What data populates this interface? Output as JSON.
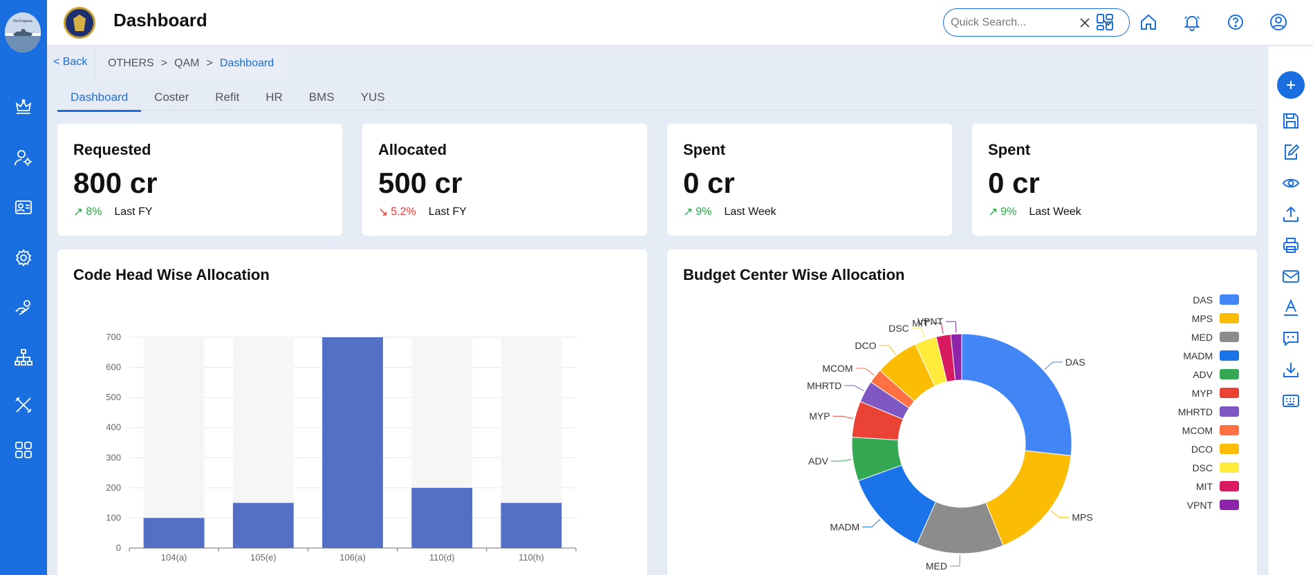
{
  "app": {
    "page_title": "Dashboard",
    "logo_caption": "RevTrapana"
  },
  "search": {
    "placeholder": "Quick Search..."
  },
  "breadcrumb": {
    "back": "< Back",
    "items": [
      "OTHERS",
      "QAM",
      "Dashboard"
    ],
    "separator": ">"
  },
  "tabs": [
    {
      "label": "Dashboard",
      "active": true
    },
    {
      "label": "Coster"
    },
    {
      "label": "Refit"
    },
    {
      "label": "HR"
    },
    {
      "label": "BMS"
    },
    {
      "label": "YUS"
    }
  ],
  "kpis": [
    {
      "title": "Requested",
      "value": "800 cr",
      "trend_arrow": "↗",
      "trend": "8%",
      "direction": "up",
      "period": "Last FY"
    },
    {
      "title": "Allocated",
      "value": "500 cr",
      "trend_arrow": "↘",
      "trend": "5.2%",
      "direction": "down",
      "period": "Last FY"
    },
    {
      "title": "Spent",
      "value": "0 cr",
      "trend_arrow": "↗",
      "trend": "9%",
      "direction": "up",
      "period": "Last Week"
    },
    {
      "title": "Spent",
      "value": "0 cr",
      "trend_arrow": "↗",
      "trend": "9%",
      "direction": "up",
      "period": "Last Week"
    }
  ],
  "sidebar_icons": [
    "crown-icon",
    "user-settings-icon",
    "id-card-icon",
    "settings-icon",
    "hand-coin-icon",
    "org-chart-icon",
    "tools-icon",
    "apps-grid-icon"
  ],
  "top_icons": [
    "dashboard-grid-icon",
    "home-icon",
    "bell-icon",
    "help-icon",
    "user-icon"
  ],
  "right_icons": [
    "save-icon",
    "edit-icon",
    "eye-icon",
    "upload-icon",
    "print-icon",
    "mail-icon",
    "font-icon",
    "comment-icon",
    "download-icon",
    "keyboard-icon"
  ],
  "colors": {
    "primary": "#1a6fe0",
    "up": "#28a745",
    "down": "#e53935",
    "bar": "#5470c6"
  },
  "chart_data": [
    {
      "type": "bar",
      "title": "Code Head Wise Allocation",
      "categories": [
        "104(a)",
        "105(e)",
        "106(a)",
        "110(d)",
        "110(h)"
      ],
      "values": [
        100,
        150,
        700,
        200,
        150
      ],
      "ylim": [
        0,
        700
      ],
      "yticks": [
        0,
        100,
        200,
        300,
        400,
        500,
        600,
        700
      ],
      "xlabel": "",
      "ylabel": "",
      "color": "#5470c6",
      "background_bars": true
    },
    {
      "type": "pie",
      "donut": true,
      "title": "Budget Center Wise Allocation",
      "legend_position": "right",
      "labels": [
        "DAS",
        "MPS",
        "MED",
        "MADM",
        "ADV",
        "MYP",
        "MHRTD",
        "MCOM",
        "DCO",
        "DSC",
        "MIT",
        "VPNT"
      ],
      "values": [
        25,
        16,
        12,
        12,
        6,
        5,
        3,
        2,
        6,
        3,
        2,
        1.5
      ],
      "colors": [
        "#4285f4",
        "#fbbc05",
        "#8c8c8c",
        "#1a73e8",
        "#34a853",
        "#ea4335",
        "#7e57c2",
        "#ff7043",
        "#fbbc04",
        "#ffeb3b",
        "#d81b60",
        "#8e24aa"
      ]
    }
  ]
}
